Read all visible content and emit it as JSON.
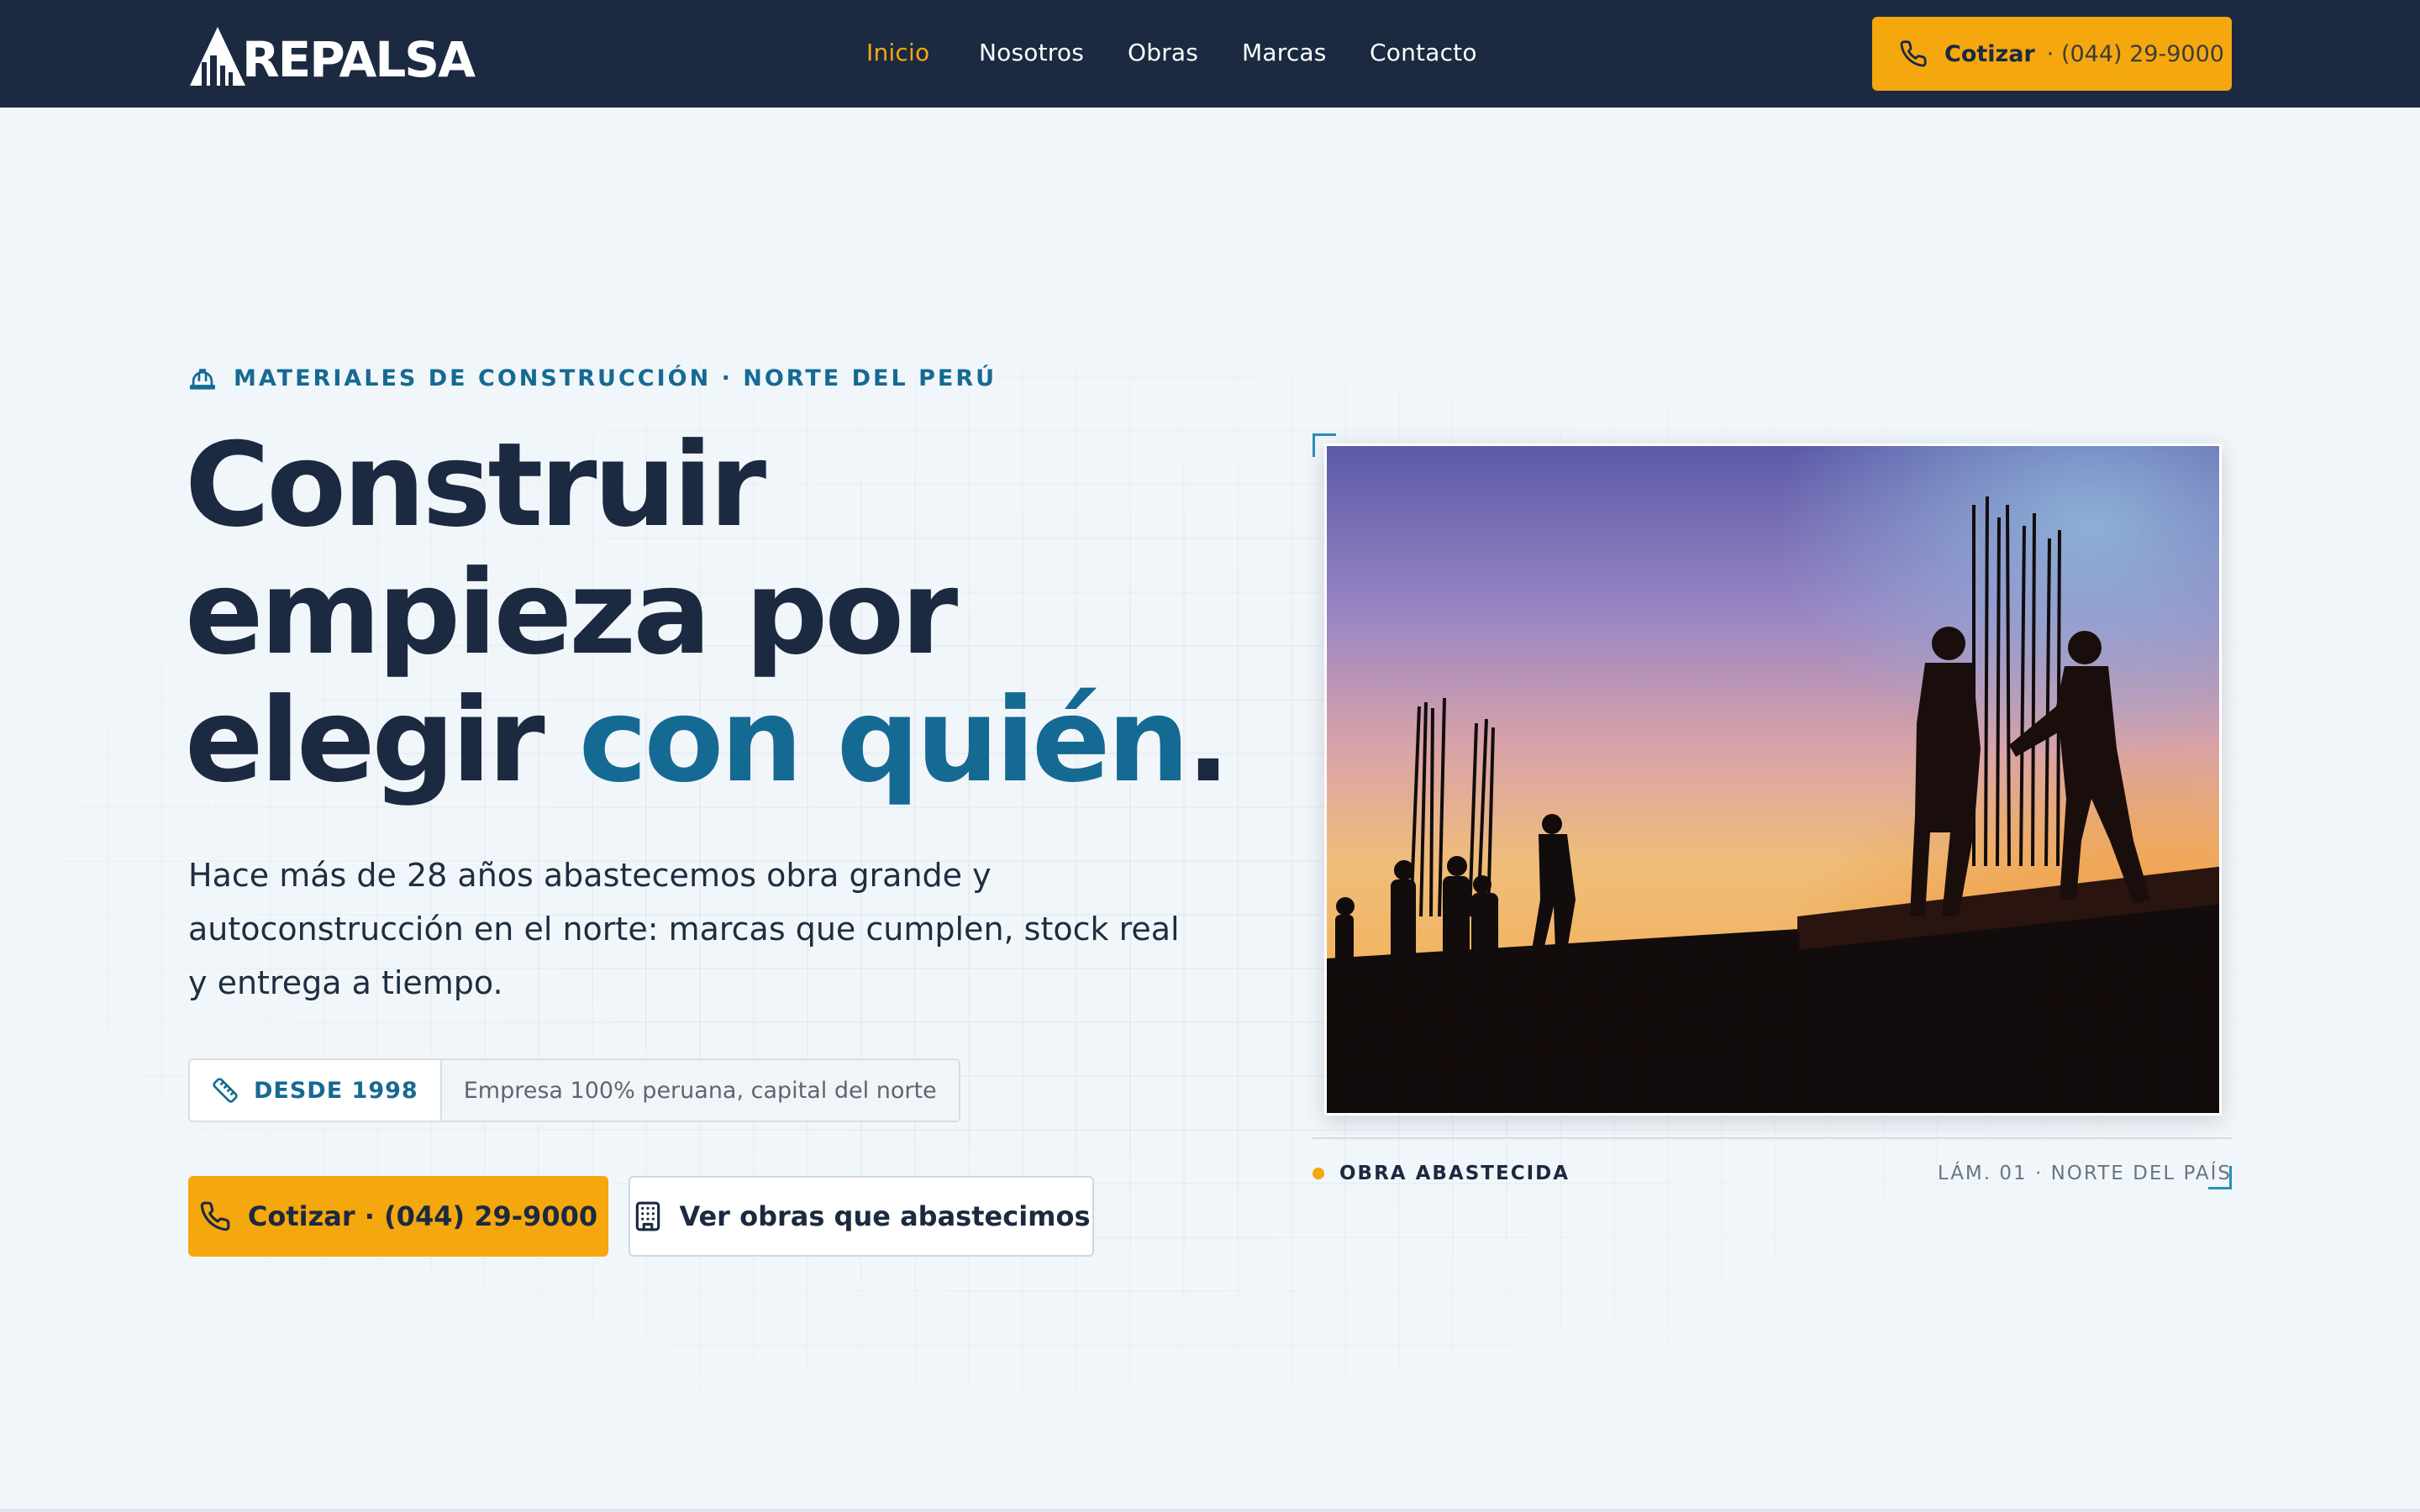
{
  "brand": {
    "name": "REPALSA"
  },
  "nav": {
    "items": [
      {
        "label": "Inicio",
        "active": true
      },
      {
        "label": "Nosotros",
        "active": false
      },
      {
        "label": "Obras",
        "active": false
      },
      {
        "label": "Marcas",
        "active": false
      },
      {
        "label": "Contacto",
        "active": false
      }
    ],
    "cta": {
      "label": "Cotizar",
      "phone": "· (044) 29-9000",
      "icon": "phone-icon"
    }
  },
  "hero": {
    "eyebrow": "MATERIALES DE CONSTRUCCIÓN · NORTE DEL PERÚ",
    "eyebrow_icon": "hard-hat-icon",
    "headline": {
      "line1": "Construir",
      "line2": "empieza por",
      "line3_plain": "elegir ",
      "line3_accent": "con quién",
      "line3_end": "."
    },
    "lead": "Hace más de 28 años abastecemos obra grande y autoconstrucción en el norte: marcas que cumplen, stock real y entrega a tiempo.",
    "badge": {
      "icon": "ruler-icon",
      "strong": "DESDE 1998",
      "text": "Empresa 100% peruana, capital del norte"
    },
    "primary_button": {
      "label": "Cotizar · (044) 29-9000",
      "icon": "phone-icon"
    },
    "secondary_button": {
      "label": "Ver obras que abastecimos",
      "icon": "building-icon"
    },
    "figure": {
      "caption_left": "OBRA ABASTECIDA",
      "caption_right": "LÁM. 01 · NORTE DEL PAÍS",
      "image_description_icon": "construction-photo"
    }
  },
  "colors": {
    "navy": "#1b2a40",
    "accent_blue": "#156a93",
    "accent_orange": "#f5a70e",
    "background": "#f1f6fa"
  }
}
